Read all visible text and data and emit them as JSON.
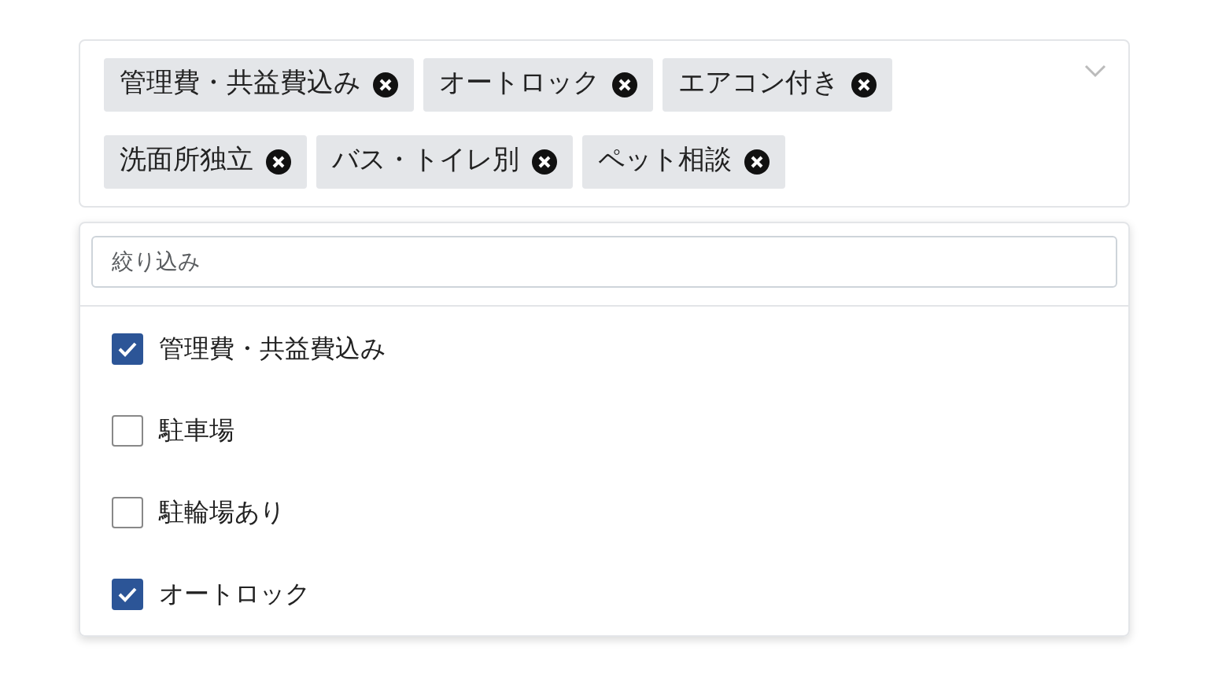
{
  "selected_tags": [
    {
      "label": "管理費・共益費込み"
    },
    {
      "label": "オートロック"
    },
    {
      "label": "エアコン付き"
    },
    {
      "label": "洗面所独立"
    },
    {
      "label": "バス・トイレ別"
    },
    {
      "label": "ペット相談"
    }
  ],
  "filter": {
    "placeholder": "絞り込み"
  },
  "options": [
    {
      "label": "管理費・共益費込み",
      "checked": true
    },
    {
      "label": "駐車場",
      "checked": false
    },
    {
      "label": "駐輪場あり",
      "checked": false
    },
    {
      "label": "オートロック",
      "checked": true
    }
  ]
}
